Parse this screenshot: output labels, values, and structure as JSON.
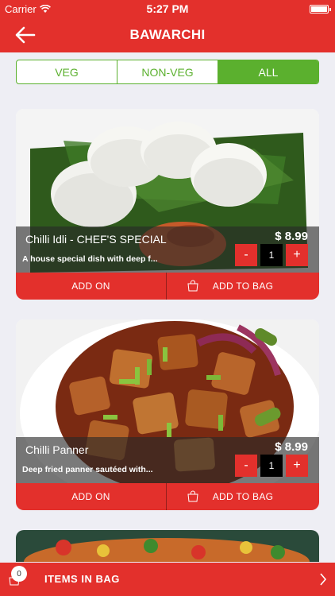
{
  "status_bar": {
    "carrier": "Carrier",
    "time": "5:27 PM"
  },
  "nav": {
    "title": "BAWARCHI",
    "back_icon": "arrow-left-icon"
  },
  "filter_tabs": [
    {
      "label": "VEG",
      "active": false
    },
    {
      "label": "NON-VEG",
      "active": false
    },
    {
      "label": "ALL",
      "active": true
    }
  ],
  "items": [
    {
      "name": "Chilli Idli - CHEF'S SPECIAL",
      "description": "A house special dish with deep f...",
      "price": "$ 8.99",
      "quantity": "1",
      "minus": "-",
      "plus": "+",
      "add_on": "ADD ON",
      "add_to_bag": "ADD TO BAG"
    },
    {
      "name": "Chilli Panner",
      "description": "Deep fried panner sautéed with...",
      "price": "$ 8.99",
      "quantity": "1",
      "minus": "-",
      "plus": "+",
      "add_on": "ADD ON",
      "add_to_bag": "ADD TO BAG"
    }
  ],
  "bag_bar": {
    "count": "0",
    "label": "ITEMS IN BAG"
  },
  "colors": {
    "brand_red": "#e3302c",
    "veg_green": "#5bb02e"
  }
}
